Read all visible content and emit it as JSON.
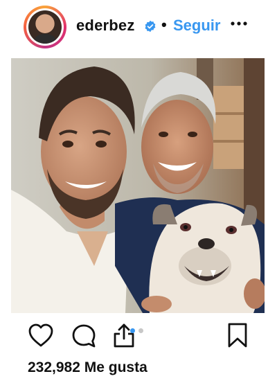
{
  "post": {
    "username": "ederbez",
    "separator": "•",
    "follow_label": "Seguir",
    "likes_text": "232,982 Me gusta",
    "carousel": {
      "count": 2,
      "active_index": 0
    }
  },
  "icons": {
    "verified": "verified-badge-icon",
    "more": "more-options-icon",
    "like": "heart-icon",
    "comment": "comment-icon",
    "share": "share-icon",
    "save": "bookmark-icon"
  },
  "colors": {
    "accent": "#3897f0",
    "verified": "#3897f0",
    "text": "#111111",
    "dot_inactive": "#c7c7c7"
  }
}
